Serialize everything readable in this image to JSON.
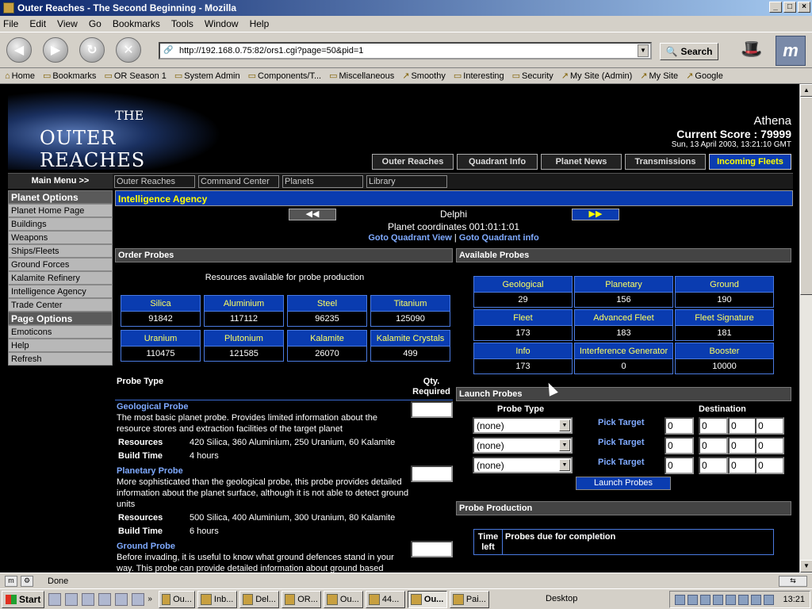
{
  "window": {
    "title": "Outer Reaches - The Second Beginning - Mozilla"
  },
  "menu": [
    "File",
    "Edit",
    "View",
    "Go",
    "Bookmarks",
    "Tools",
    "Window",
    "Help"
  ],
  "toolbar": {
    "url": "http://192.168.0.75:82/ors1.cgi?page=50&pid=1",
    "search_label": "Search"
  },
  "bookmarks": [
    "Home",
    "Bookmarks",
    "OR Season 1",
    "System Admin",
    "Components/T...",
    "Miscellaneous",
    "Smoothy",
    "Interesting",
    "Security",
    "My Site (Admin)",
    "My Site",
    "Google"
  ],
  "logo": {
    "the": "THE",
    "name": "OUTER REACHES"
  },
  "player": {
    "name": "Athena",
    "score": "Current Score : 79999",
    "date": "Sun, 13 April 2003, 13:21:10 GMT"
  },
  "tabs": [
    {
      "label": "Outer Reaches"
    },
    {
      "label": "Quadrant Info"
    },
    {
      "label": "Planet News"
    },
    {
      "label": "Transmissions"
    },
    {
      "label": "Incoming Fleets"
    }
  ],
  "mainmenu": {
    "label": "Main Menu >>",
    "items": [
      "Outer Reaches",
      "Command Center",
      "Planets",
      "Library"
    ]
  },
  "sidebar": {
    "planet_head": "Planet Options",
    "planet_items": [
      "Planet Home Page",
      "Buildings",
      "Weapons",
      "Ships/Fleets",
      "Ground Forces",
      "Kalamite Refinery",
      "Intelligence Agency",
      "Trade Center"
    ],
    "page_head": "Page Options",
    "page_items": [
      "Emoticons",
      "Help",
      "Refresh"
    ]
  },
  "page": {
    "heading": "Intelligence Agency",
    "prev": "◀◀",
    "next": "▶▶",
    "planet": "Delphi",
    "coords": "Planet coordinates 001:01:1:01",
    "goto_view": "Goto Quadrant View",
    "goto_sep": "|",
    "goto_info": "Goto Quadrant info"
  },
  "order": {
    "title": "Order Probes",
    "note": "Resources available for probe production",
    "resources": [
      {
        "name": "Silica",
        "value": "91842"
      },
      {
        "name": "Aluminium",
        "value": "117112"
      },
      {
        "name": "Steel",
        "value": "96235"
      },
      {
        "name": "Titanium",
        "value": "125090"
      },
      {
        "name": "Uranium",
        "value": "110475"
      },
      {
        "name": "Plutonium",
        "value": "121585"
      },
      {
        "name": "Kalamite",
        "value": "26070"
      },
      {
        "name": "Kalamite Crystals",
        "value": "499"
      }
    ],
    "probe_type_header": "Probe Type",
    "qty_header": "Qty. Required",
    "probes": [
      {
        "name": "Geological Probe",
        "desc": "The most basic planet probe. Provides limited information about the resource stores and extraction facilities of the target planet",
        "res_label": "Resources",
        "res": "420 Silica, 360 Aluminium, 250 Uranium, 60 Kalamite",
        "time_label": "Build Time",
        "time": "4 hours"
      },
      {
        "name": "Planetary Probe",
        "desc": "More sophisticated than the geological probe, this probe provides detailed information about the planet surface, although it is not able to detect ground units",
        "res_label": "Resources",
        "res": "500 Silica, 400 Aluminium, 300 Uranium, 80 Kalamite",
        "time_label": "Build Time",
        "time": "6 hours"
      },
      {
        "name": "Ground Probe",
        "desc": "Before invading, it is useful to know what ground defences stand in your way. This probe can provide detailed information about ground based"
      }
    ]
  },
  "available": {
    "title": "Available Probes",
    "probes": [
      {
        "name": "Geological",
        "value": "29"
      },
      {
        "name": "Planetary",
        "value": "156"
      },
      {
        "name": "Ground",
        "value": "190"
      },
      {
        "name": "Fleet",
        "value": "173"
      },
      {
        "name": "Advanced Fleet",
        "value": "183"
      },
      {
        "name": "Fleet Signature",
        "value": "181"
      },
      {
        "name": "Info",
        "value": "173"
      },
      {
        "name": "Interference Generator",
        "value": "0"
      },
      {
        "name": "Booster",
        "value": "10000"
      }
    ]
  },
  "launch": {
    "title": "Launch Probes",
    "type_header": "Probe Type",
    "dest_header": "Destination",
    "rows": [
      {
        "select": "(none)",
        "pick": "Pick Target",
        "coords": [
          "0",
          "0",
          "0",
          "0"
        ]
      },
      {
        "select": "(none)",
        "pick": "Pick Target",
        "coords": [
          "0",
          "0",
          "0",
          "0"
        ]
      },
      {
        "select": "(none)",
        "pick": "Pick Target",
        "coords": [
          "0",
          "0",
          "0",
          "0"
        ]
      }
    ],
    "button": "Launch Probes"
  },
  "production": {
    "title": "Probe Production",
    "col1": "Time left",
    "col2": "Probes due for completion"
  },
  "status": {
    "text": "Done"
  },
  "taskbar": {
    "start": "Start",
    "tasks": [
      "Ou...",
      "Inb...",
      "Del...",
      "OR...",
      "Ou...",
      "44...",
      "Ou...",
      "Pai..."
    ],
    "desktop": "Desktop",
    "clock": "13:21"
  }
}
